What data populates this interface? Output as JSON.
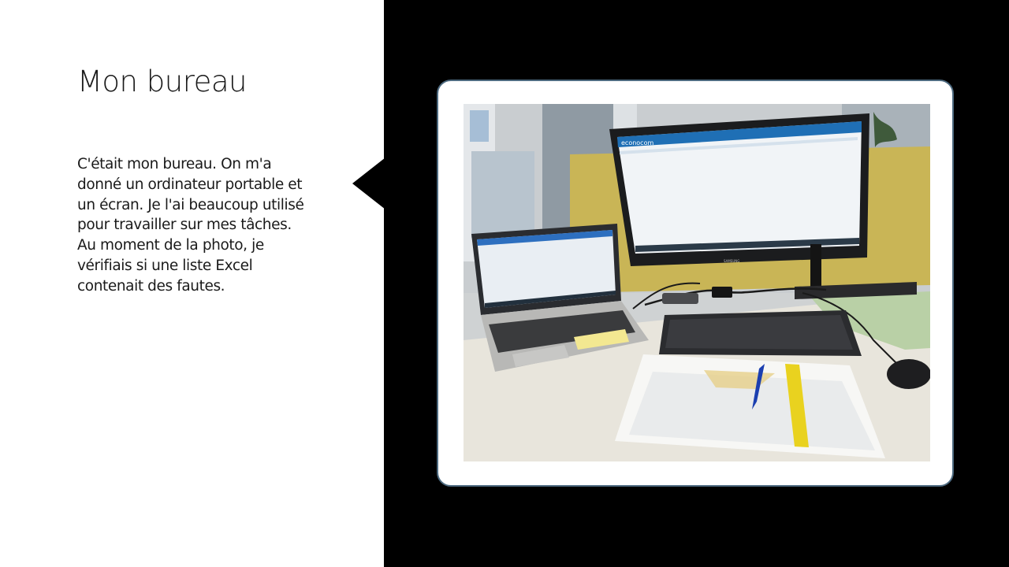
{
  "slide": {
    "title": "Mon bureau",
    "body_lines": [
      "C'était mon bureau. On m'a",
      "donné un ordinateur portable et",
      "un écran. Je l'ai beaucoup utilisé",
      "pour travailler sur mes tâches.",
      "Au moment de la photo, je",
      "vérifiais si une liste Excel",
      "contenait des fautes."
    ]
  },
  "photo": {
    "monitor_brand_text": "econocom",
    "monitor_bezel_text": "SAMSUNG"
  },
  "colors": {
    "background_left": "#ffffff",
    "background_right": "#000000",
    "frame_border": "#4d6a80"
  }
}
